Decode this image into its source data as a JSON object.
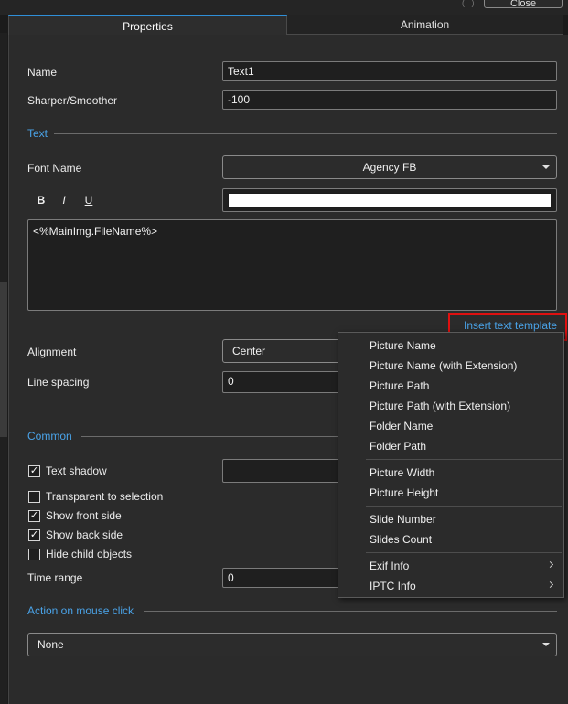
{
  "window": {
    "close_label": "Close",
    "top_dots": "(...)"
  },
  "tabs": [
    {
      "label": "Properties",
      "active": true
    },
    {
      "label": "Animation",
      "active": false
    }
  ],
  "props": {
    "name_label": "Name",
    "name_value": "Text1",
    "sharper_label": "Sharper/Smoother",
    "sharper_value": "-100"
  },
  "text_section": {
    "title": "Text",
    "font_label": "Font Name",
    "font_value": "Agency FB",
    "bold": "B",
    "italic": "I",
    "underline": "U",
    "color": "#ffffff",
    "content": "<%MainImg.FileName%>",
    "insert_template": "Insert text template",
    "alignment_label": "Alignment",
    "alignment_value": "Center",
    "line_spacing_label": "Line spacing",
    "line_spacing_value": "0"
  },
  "common": {
    "title": "Common",
    "checkboxes": [
      {
        "label": "Text shadow",
        "checked": true
      },
      {
        "label": "Transparent to selection",
        "checked": false
      },
      {
        "label": "Show front side",
        "checked": true
      },
      {
        "label": "Show back side",
        "checked": true
      },
      {
        "label": "Hide child objects",
        "checked": false
      }
    ],
    "time_range_label": "Time range",
    "time_range_value": "0"
  },
  "action": {
    "title": "Action on mouse click",
    "value": "None"
  },
  "menu": {
    "items": [
      "Picture Name",
      "Picture Name (with Extension)",
      "Picture Path",
      "Picture Path (with Extension)",
      "Folder Name",
      "Folder Path",
      "Picture Width",
      "Picture Height",
      "Slide Number",
      "Slides Count",
      "Exif Info",
      "IPTC Info"
    ]
  },
  "colors": {
    "accent": "#4aa3e8",
    "highlight": "#e01010",
    "panel_bg": "#2b2b2b"
  }
}
